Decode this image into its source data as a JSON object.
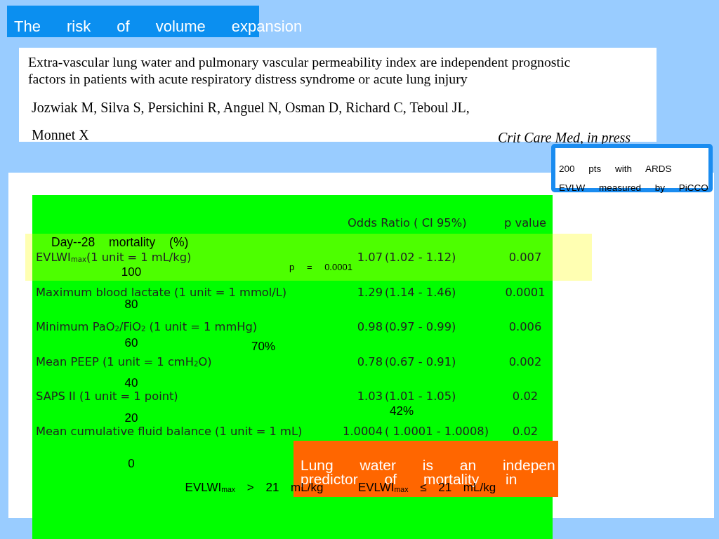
{
  "title": "The risk of volume expansion",
  "reference": {
    "article_title": "Extra-vascular lung water and pulmonary vascular permeability index are independent prognostic factors in patients with acute respiratory distress syndrome or acute lung injury",
    "authors": [
      "Jozwiak M, Silva S, Persichini R, Anguel N, Osman D, Richard C, Teboul JL,",
      "Monnet X"
    ],
    "journal": "Crit Care Med, in press"
  },
  "study_box": {
    "lines": [
      "200 pts with ARDS",
      "EVLW measured by PiCCO"
    ]
  },
  "odds_table": {
    "columns": [
      "Odds Ratio ( CI 95%)",
      "p value"
    ],
    "rows": [
      {
        "variable": "EVLWI$_{max}$(1 unit = 1 mL/kg)",
        "odds_ratio": "1.07",
        "ci": "(1.02 - 1.12)",
        "p_value": "0.007"
      },
      {
        "variable": "Maximum blood lactate (1 unit = 1 mmol/L)",
        "odds_ratio": "1.29",
        "ci": "(1.14 - 1.46)",
        "p_value": "0.0001"
      },
      {
        "variable": "Minimum PaO$_{2}$/FiO$_{2}$ (1 unit = 1 mmHg)",
        "odds_ratio": "0.98",
        "ci": "(0.97 - 0.99)",
        "p_value": "0.006"
      },
      {
        "variable": "Mean PEEP (1 unit = 1 cmH$_{2}$O)",
        "odds_ratio": "0.78",
        "ci": "(0.67 - 0.91)",
        "p_value": "0.002"
      },
      {
        "variable": "SAPS II (1 unit = 1 point)",
        "odds_ratio": "1.03",
        "ci": "(1.01 - 1.05)",
        "p_value": "0.02"
      },
      {
        "variable": "Mean cumulative fluid balance (1 unit = 1 mL)",
        "odds_ratio": "1.0004",
        "ci": "( 1.0001 - 1.0008)",
        "p_value": "0.02"
      }
    ]
  },
  "mortality_chart": {
    "title": "Day--28 mortality (%)",
    "y_ticks": [
      "100",
      "80",
      "60",
      "40",
      "20",
      "0"
    ],
    "p_value": "p = 0.0001",
    "value_labels": [
      "70%",
      "42%"
    ],
    "categories": [
      "EVLWI$_{max}$ > 21 mL/kg",
      "EVLWI$_{max}$ ≤ 21 mL/kg"
    ]
  },
  "conclusion_box": {
    "lines": [
      "Lung water is an indepen",
      "predictor of mortality in"
    ]
  }
}
